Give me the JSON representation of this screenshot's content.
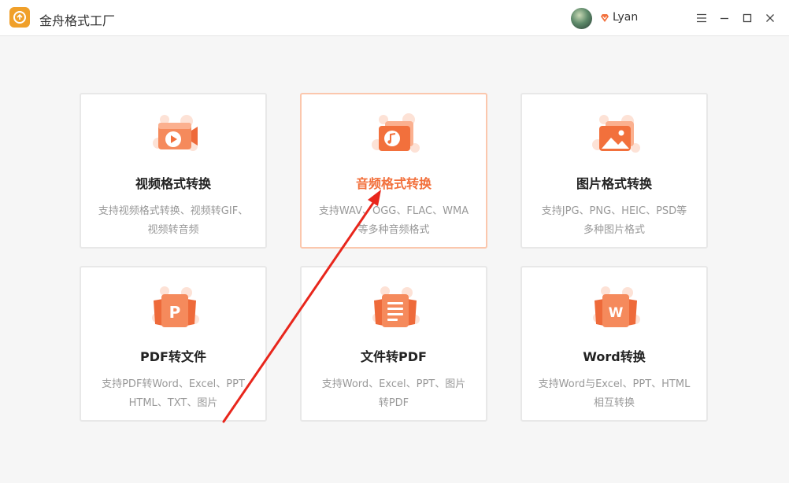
{
  "app": {
    "title": "金舟格式工厂"
  },
  "user": {
    "name": "Lyan"
  },
  "colors": {
    "accent": "#f2703c",
    "active_border": "#fbc7ad",
    "arrow": "#e8261c"
  },
  "cards": [
    {
      "title": "视频格式转换",
      "desc_line1": "支持视频格式转换、视频转GIF、",
      "desc_line2": "视频转音频",
      "icon": "video-convert-icon"
    },
    {
      "title": "音频格式转换",
      "desc_line1": "支持WAV、OGG、FLAC、WMA",
      "desc_line2": "等多种音频格式",
      "icon": "audio-convert-icon"
    },
    {
      "title": "图片格式转换",
      "desc_line1": "支持JPG、PNG、HEIC、PSD等",
      "desc_line2": "多种图片格式",
      "icon": "image-convert-icon"
    },
    {
      "title": "PDF转文件",
      "desc_line1": "支持PDF转Word、Excel、PPT",
      "desc_line2": "HTML、TXT、图片",
      "icon": "pdf-to-file-icon",
      "glyph": "P"
    },
    {
      "title": "文件转PDF",
      "desc_line1": "支持Word、Excel、PPT、图片",
      "desc_line2": "转PDF",
      "icon": "file-to-pdf-icon"
    },
    {
      "title": "Word转换",
      "desc_line1": "支持Word与Excel、PPT、HTML",
      "desc_line2": "相互转换",
      "icon": "word-convert-icon",
      "glyph": "W"
    }
  ]
}
